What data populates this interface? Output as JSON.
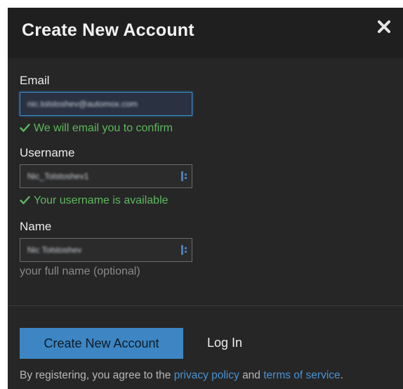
{
  "dialog": {
    "title": "Create New Account",
    "close_icon": "close-icon"
  },
  "fields": {
    "email": {
      "label": "Email",
      "value": "nic.tolstoshev@automox.com",
      "hint": "We will email you to confirm"
    },
    "username": {
      "label": "Username",
      "value": "Nic_Tolstoshev1",
      "hint": "Your username is available"
    },
    "name": {
      "label": "Name",
      "value": "Nic Tolstoshev",
      "hint": "your full name (optional)"
    }
  },
  "actions": {
    "create_label": "Create New Account",
    "login_label": "Log In"
  },
  "legal": {
    "prefix": "By registering, you agree to the",
    "privacy_link": "privacy policy",
    "conjunction": "and",
    "terms_link": "terms of service",
    "suffix": "."
  },
  "colors": {
    "dialog_bg": "#262626",
    "header_bg": "#1f1f1f",
    "accent": "#3d86c3",
    "success": "#5fb85f",
    "link": "#4a92d2"
  }
}
